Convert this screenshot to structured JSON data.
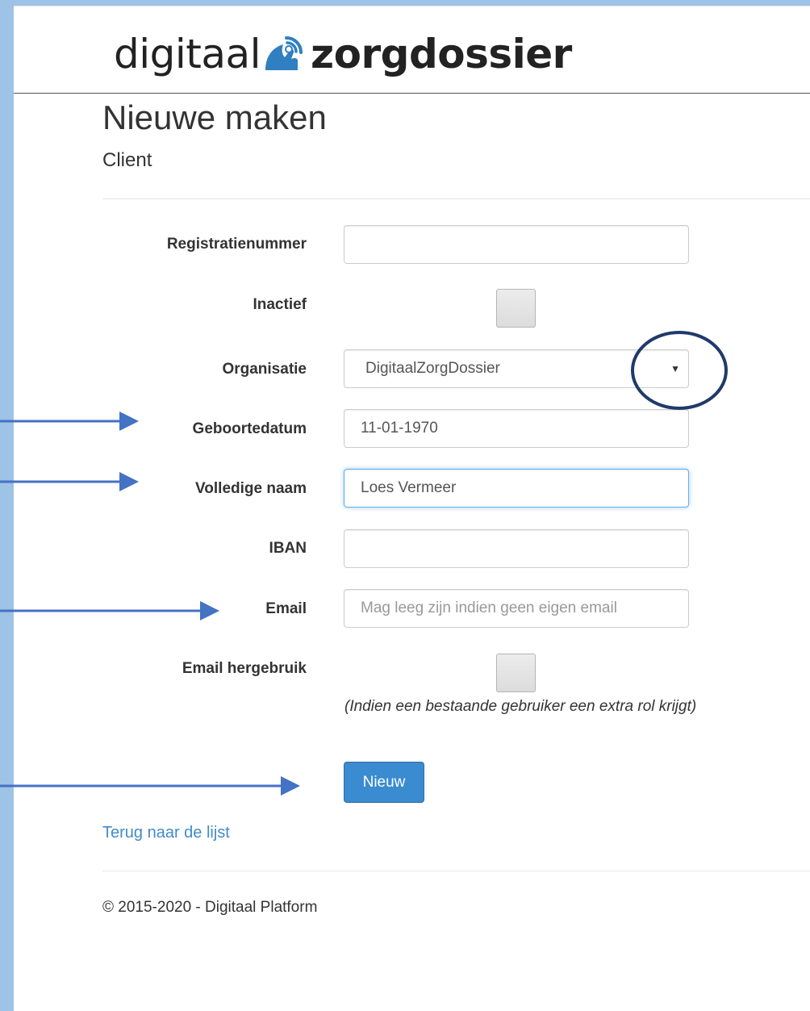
{
  "header": {
    "logo_text_light": "digitaal",
    "logo_text_bold": "zorgdossier",
    "logo_icon": "hand-touch-icon",
    "colors": {
      "logo_icon_blue": "#2f7fc1",
      "frame": "#9dc3e6"
    }
  },
  "page": {
    "title": "Nieuwe maken",
    "subtitle": "Client"
  },
  "form": {
    "registratienummer": {
      "label": "Registratienummer",
      "value": ""
    },
    "inactief": {
      "label": "Inactief",
      "checked": false
    },
    "organisatie": {
      "label": "Organisatie",
      "value": "DigitaalZorgDossier",
      "caret": "▼"
    },
    "geboortedatum": {
      "label": "Geboortedatum",
      "value": "11-01-1970"
    },
    "volledige_naam": {
      "label": "Volledige naam",
      "value": "Loes Vermeer"
    },
    "iban": {
      "label": "IBAN",
      "value": ""
    },
    "email": {
      "label": "Email",
      "value": "",
      "placeholder": "Mag leeg zijn indien geen eigen email"
    },
    "email_hergebruik": {
      "label": "Email hergebruik",
      "checked": false,
      "help": "(Indien een bestaande gebruiker een extra rol krijgt)"
    },
    "submit_label": "Nieuw"
  },
  "links": {
    "back": "Terug naar de lijst"
  },
  "footer": {
    "text": "© 2015-2020 - Digitaal Platform"
  },
  "annotations": {
    "color": "#4472c4"
  }
}
